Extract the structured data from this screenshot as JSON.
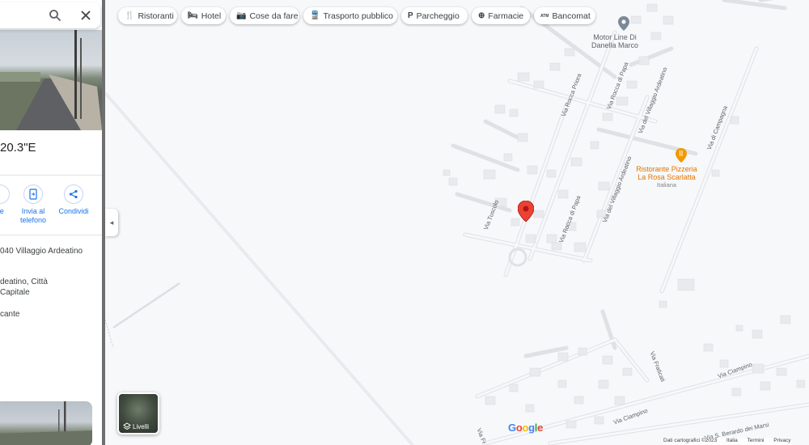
{
  "chips": [
    {
      "label": "Ristoranti",
      "icon": "restaurant-icon",
      "glyph": "🍴"
    },
    {
      "label": "Hotel",
      "icon": "hotel-icon",
      "glyph": "🛏"
    },
    {
      "label": "Cose da fare",
      "icon": "camera-icon",
      "glyph": "📷"
    },
    {
      "label": "Trasporto pubblico",
      "icon": "transit-icon",
      "glyph": "🚆"
    },
    {
      "label": "Parcheggio",
      "icon": "parking-icon",
      "glyph": "P"
    },
    {
      "label": "Farmacie",
      "icon": "pharmacy-icon",
      "glyph": "⊕"
    },
    {
      "label": "Bancomat",
      "icon": "atm-icon",
      "glyph": "ATM"
    }
  ],
  "panel": {
    "coordinates": "20.3\"E",
    "actions": [
      {
        "label": "ze",
        "icon": "save-icon"
      },
      {
        "label": "Invia al telefono",
        "icon": "send-to-phone-icon"
      },
      {
        "label": "Condividi",
        "icon": "share-icon"
      }
    ],
    "address": "040 Villaggio Ardeatino",
    "locality_line1": "deatino, Città",
    "locality_line2": "Capitale",
    "plus_code": "cante"
  },
  "map": {
    "streets": [
      "Via Rocca Priora",
      "Via Rocca di Papa",
      "Via del Villaggio Ardeatino",
      "Via del Villaggio Ardeatino",
      "Via di Campagna",
      "Via Tuscolo",
      "Via Rocca di Papa",
      "Via Fraticati",
      "Via Ciampino",
      "Via Ciampino",
      "Via S. Berardo dei Marsi",
      "Via Fr"
    ],
    "pois": [
      {
        "name_line1": "Motor Line Di",
        "name_line2": "Danella Marco",
        "name_line3": "",
        "color": "#5f6368",
        "icon": "place-pin-icon"
      },
      {
        "name_line1": "Ristorante Pizzeria",
        "name_line2": "La Rosa Scarlatta",
        "name_line3": "Italiana",
        "color": "#e37400",
        "icon": "restaurant-pin-icon"
      }
    ],
    "marker_color": "#ea4335"
  },
  "controls": {
    "layers_label": "Livelli",
    "collapse_glyph": "◂"
  },
  "branding": {
    "google_letters": [
      "G",
      "o",
      "o",
      "g",
      "l",
      "e"
    ],
    "google_colors": [
      "#4285f4",
      "#ea4335",
      "#fbbc05",
      "#4285f4",
      "#34a853",
      "#ea4335"
    ]
  },
  "attribution": {
    "data": "Dati cartografici ©2023",
    "country": "Italia",
    "terms": "Termini",
    "privacy": "Privacy"
  }
}
